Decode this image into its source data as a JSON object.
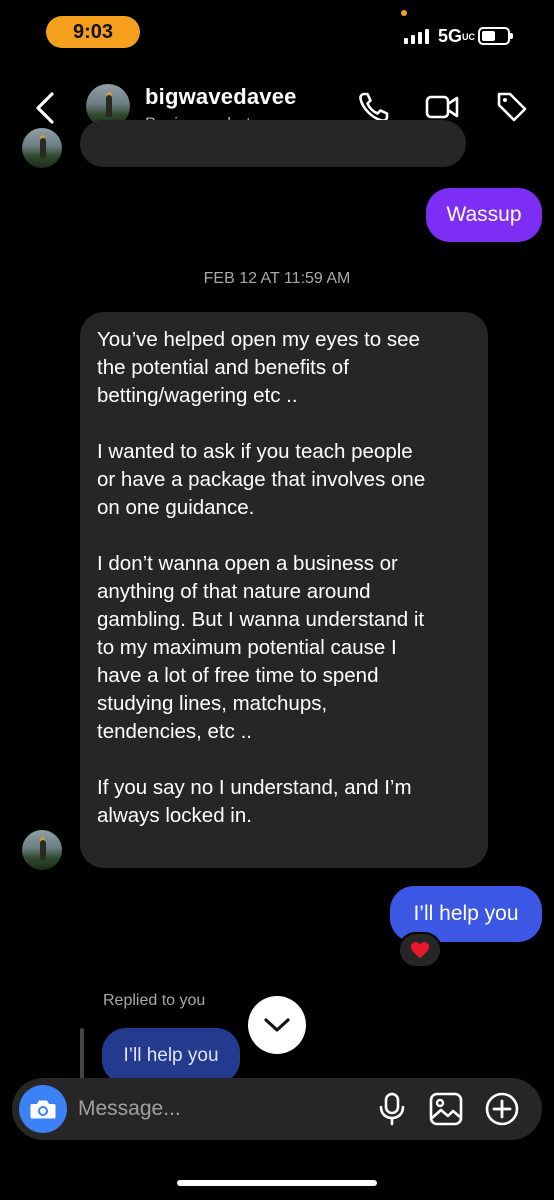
{
  "status_bar": {
    "time": "9:03",
    "network": "5G",
    "network_suffix": "UC"
  },
  "header": {
    "name": "bigwavedavee",
    "subtitle": "Business chat"
  },
  "messages": {
    "sent_1": "Wassup",
    "date_separator": "FEB 12 AT 11:59 AM",
    "received_long": "You’ve helped open my eyes to see\nthe potential and benefits of\nbetting/wagering etc ..\n\nI wanted to ask if you teach people\nor have a package that involves one\non one guidance.\n\nI don’t wanna open a business or\nanything of that nature around\ngambling. But I wanna understand it\nto my maximum potential cause I\nhave a lot of free time to spend\nstudying lines, matchups,\ntendencies, etc ..\n\nIf you say no I understand, and I’m\nalways locked in.",
    "sent_2": "I’ll help you",
    "reaction": "❤️",
    "replied_label": "Replied to you",
    "reply_quote": "I’ll help you"
  },
  "composer": {
    "placeholder": "Message..."
  },
  "icons": {
    "back": "chevron-left-icon",
    "call": "phone-icon",
    "video": "video-camera-icon",
    "tag": "tag-icon",
    "scroll": "chevron-down-icon",
    "camera": "camera-icon",
    "mic": "microphone-icon",
    "gallery": "image-icon",
    "plus": "plus-circle-icon"
  },
  "colors": {
    "sent_purple": "#7d2ef5",
    "sent_blue": "#3b57e3",
    "received": "#262626",
    "time_pill": "#f59f1d",
    "camera_button": "#3c82f6"
  }
}
